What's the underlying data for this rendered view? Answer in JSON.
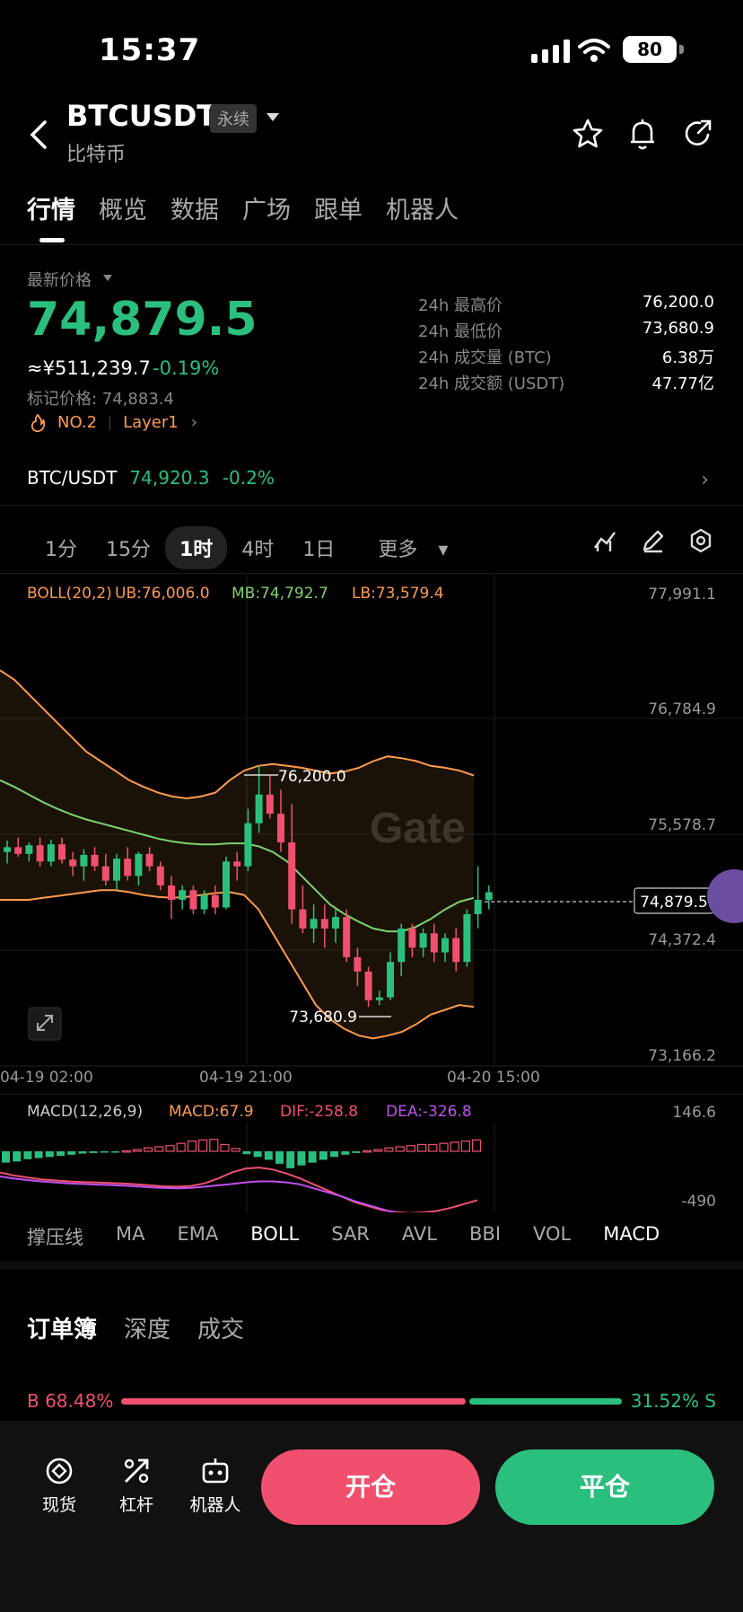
{
  "status": {
    "time": "15:37",
    "battery": "80"
  },
  "header": {
    "symbol": "BTCUSDT",
    "contract": "永续",
    "name": "比特币"
  },
  "tabs": [
    "行情",
    "概览",
    "数据",
    "广场",
    "跟单",
    "机器人"
  ],
  "price": {
    "label": "最新价格",
    "last": "74,879.5",
    "cny": "≈¥511,239.7",
    "change": "-0.19%",
    "mark": "标记价格: 74,883.4",
    "rank": "NO.2",
    "tag": "Layer1"
  },
  "stats": [
    {
      "k": "24h 最高价",
      "v": "76,200.0"
    },
    {
      "k": "24h 最低价",
      "v": "73,680.9"
    },
    {
      "k": "24h 成交量 (BTC)",
      "v": "6.38万"
    },
    {
      "k": "24h 成交额 (USDT)",
      "v": "47.77亿"
    }
  ],
  "spot": {
    "pair": "BTC/USDT",
    "price": "74,920.3",
    "change": "-0.2%"
  },
  "timeframes": [
    "1分",
    "15分",
    "1时",
    "4时",
    "1日",
    "更多"
  ],
  "chart": {
    "boll": {
      "label": "BOLL(20,2)",
      "ub": "UB:76,006.0",
      "mb": "MB:74,792.7",
      "lb": "LB:73,579.4"
    },
    "yticks": [
      "77,991.1",
      "76,784.9",
      "75,578.7",
      "74,372.4",
      "73,166.2"
    ],
    "xticks": [
      "04-19 02:00",
      "04-19 21:00",
      "04-20 15:00"
    ],
    "high_label": "76,200.0",
    "low_label": "73,680.9",
    "last_label": "74,879.5",
    "macd": {
      "label": "MACD(12,26,9)",
      "macd": "MACD:67.9",
      "dif": "DIF:-258.8",
      "dea": "DEA:-326.8",
      "top": "146.6",
      "bottom": "-490"
    },
    "watermark": "Gate"
  },
  "chart_data": {
    "type": "candlestick",
    "ylim": [
      73166.2,
      77991.1
    ],
    "candles": [
      [
        75300,
        75420,
        75180,
        75350
      ],
      [
        75350,
        75450,
        75250,
        75280
      ],
      [
        75280,
        75400,
        75200,
        75370
      ],
      [
        75370,
        75450,
        75150,
        75200
      ],
      [
        75200,
        75430,
        75150,
        75380
      ],
      [
        75380,
        75450,
        75180,
        75220
      ],
      [
        75220,
        75300,
        75050,
        75150
      ],
      [
        75150,
        75330,
        75000,
        75270
      ],
      [
        75270,
        75350,
        75100,
        75150
      ],
      [
        75150,
        75280,
        74950,
        75000
      ],
      [
        75000,
        75280,
        74900,
        75230
      ],
      [
        75230,
        75350,
        75000,
        75050
      ],
      [
        75050,
        75300,
        74950,
        75280
      ],
      [
        75280,
        75350,
        75100,
        75150
      ],
      [
        75150,
        75200,
        74900,
        74950
      ],
      [
        74950,
        75050,
        74600,
        74800
      ],
      [
        74800,
        74950,
        74700,
        74900
      ],
      [
        74900,
        74950,
        74650,
        74700
      ],
      [
        74700,
        74900,
        74650,
        74850
      ],
      [
        74850,
        74950,
        74650,
        74720
      ],
      [
        74720,
        75250,
        74700,
        75200
      ],
      [
        75200,
        75300,
        75000,
        75150
      ],
      [
        75150,
        75750,
        75100,
        75600
      ],
      [
        75600,
        76200,
        75500,
        75900
      ],
      [
        75900,
        76100,
        75650,
        75700
      ],
      [
        75700,
        75950,
        75300,
        75400
      ],
      [
        75400,
        75800,
        74550,
        74700
      ],
      [
        74700,
        74950,
        74450,
        74500
      ],
      [
        74500,
        74750,
        74350,
        74600
      ],
      [
        74600,
        74750,
        74300,
        74500
      ],
      [
        74500,
        74700,
        74350,
        74620
      ],
      [
        74620,
        74700,
        74150,
        74200
      ],
      [
        74200,
        74300,
        73900,
        74050
      ],
      [
        74050,
        74100,
        73680.9,
        73750
      ],
      [
        73750,
        73850,
        73700,
        73780
      ],
      [
        73780,
        74250,
        73750,
        74150
      ],
      [
        74150,
        74550,
        74000,
        74500
      ],
      [
        74500,
        74550,
        74200,
        74300
      ],
      [
        74300,
        74500,
        74200,
        74450
      ],
      [
        74450,
        74550,
        74150,
        74250
      ],
      [
        74250,
        74450,
        74150,
        74400
      ],
      [
        74400,
        74500,
        74050,
        74150
      ],
      [
        74150,
        74700,
        74100,
        74650
      ],
      [
        74650,
        75150,
        74500,
        74800
      ],
      [
        74800,
        74950,
        74700,
        74879.5
      ]
    ],
    "boll_ub": [
      77200,
      77100,
      76950,
      76800,
      76650,
      76500,
      76350,
      76250,
      76150,
      76050,
      75980,
      75920,
      75880,
      75860,
      75880,
      75920,
      76050,
      76150,
      76200,
      76220,
      76200,
      76180,
      76150,
      76120,
      76140,
      76180,
      76250,
      76300,
      76280,
      76250,
      76200,
      76180,
      76150,
      76100
    ],
    "boll_mb": [
      76050,
      75980,
      75900,
      75820,
      75750,
      75690,
      75640,
      75600,
      75560,
      75520,
      75480,
      75440,
      75410,
      75390,
      75380,
      75380,
      75390,
      75390,
      75360,
      75300,
      75200,
      75050,
      74900,
      74750,
      74650,
      74570,
      74500,
      74470,
      74470,
      74520,
      74600,
      74700,
      74780,
      74820
    ],
    "boll_lb": [
      74800,
      74800,
      74800,
      74820,
      74840,
      74860,
      74880,
      74900,
      74900,
      74880,
      74850,
      74830,
      74820,
      74830,
      74850,
      74870,
      74880,
      74850,
      74700,
      74450,
      74200,
      73950,
      73700,
      73550,
      73450,
      73380,
      73350,
      73380,
      73420,
      73500,
      73600,
      73650,
      73700,
      73680
    ],
    "macd_hist": [
      -20,
      -18,
      -14,
      -12,
      -10,
      -8,
      -6,
      -4,
      -3,
      -2,
      -1,
      1,
      3,
      6,
      8,
      10,
      14,
      18,
      20,
      21,
      12,
      5,
      -5,
      -10,
      -15,
      -22,
      -30,
      -25,
      -20,
      -15,
      -10,
      -6,
      -3,
      1,
      3,
      6,
      8,
      10,
      12,
      12,
      14,
      16,
      18,
      20
    ],
    "dif": [
      -80,
      -95,
      -105,
      -115,
      -120,
      -125,
      -128,
      -130,
      -133,
      -135,
      -140,
      -145,
      -150,
      -152,
      -148,
      -135,
      -110,
      -80,
      -60,
      -55,
      -65,
      -85,
      -110,
      -140,
      -170,
      -200,
      -230,
      -250,
      -270,
      -280,
      -285,
      -282,
      -275,
      -260,
      -240,
      -220
    ],
    "dea": [
      -100,
      -110,
      -118,
      -125,
      -130,
      -135,
      -138,
      -141,
      -143,
      -146,
      -150,
      -155,
      -158,
      -160,
      -158,
      -152,
      -145,
      -138,
      -130,
      -125,
      -125,
      -130,
      -140,
      -160,
      -180,
      -200,
      -225,
      -245,
      -265,
      -285,
      -300,
      -310,
      -318,
      -322,
      -326,
      -326
    ]
  },
  "indicators": [
    "撑压线",
    "MA",
    "EMA",
    "BOLL",
    "SAR",
    "AVL",
    "BBI",
    "VOL",
    "MACD"
  ],
  "orderbook": {
    "tabs": [
      "订单簿",
      "深度",
      "成交"
    ],
    "buy": "B 68.48%",
    "sell": "31.52% S"
  },
  "bottom": {
    "items": [
      "现货",
      "杠杆",
      "机器人"
    ],
    "open": "开仓",
    "close": "平仓"
  }
}
